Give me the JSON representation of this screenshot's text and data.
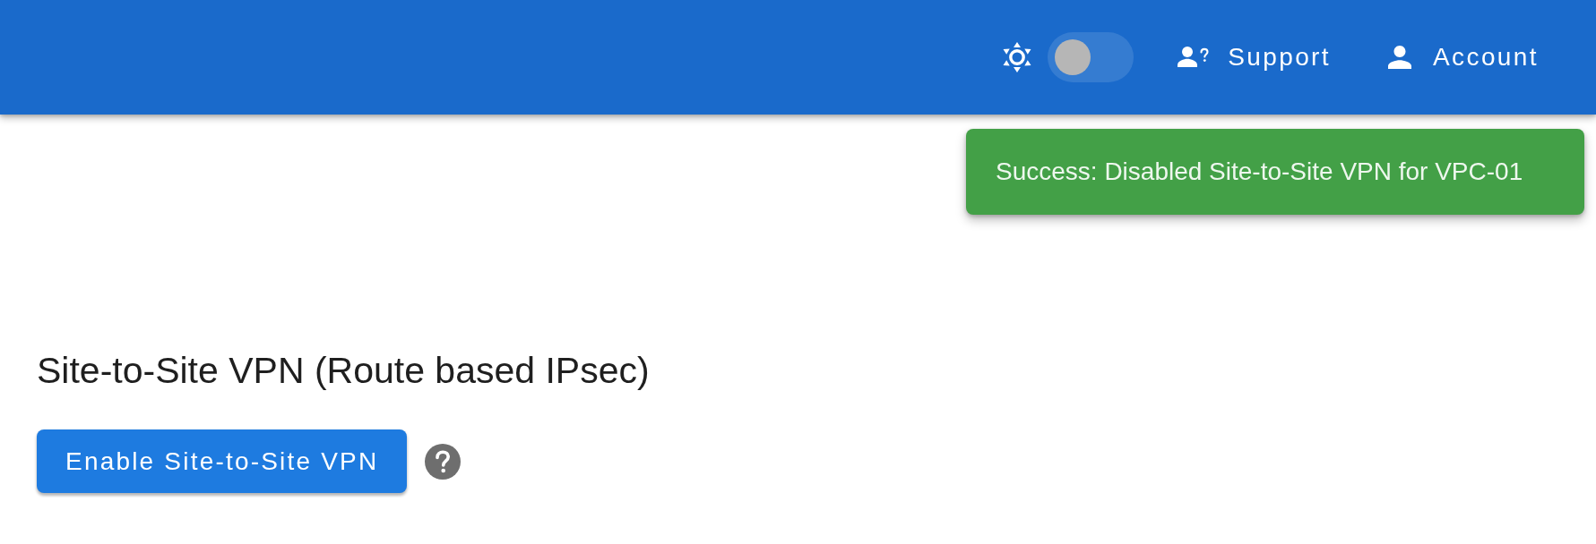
{
  "header": {
    "theme_toggle": {
      "on": false
    },
    "nav": [
      {
        "label": "Support",
        "kind": "support"
      },
      {
        "label": "Account",
        "kind": "account"
      }
    ]
  },
  "toast": {
    "kind": "success",
    "message": "Success: Disabled Site-to-Site VPN for VPC-01"
  },
  "section": {
    "title": "Site-to-Site VPN (Route based IPsec)",
    "primary_button": "Enable Site-to-Site VPN"
  }
}
